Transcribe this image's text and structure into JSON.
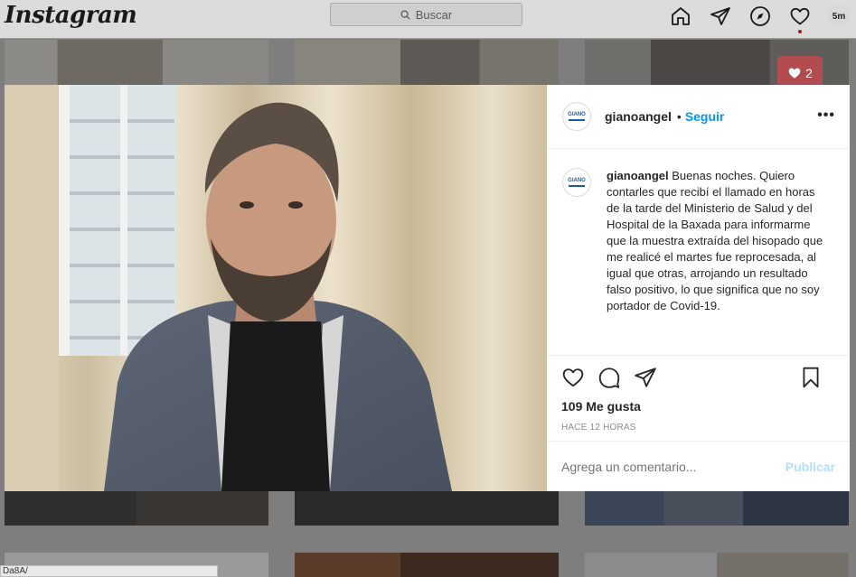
{
  "nav": {
    "logo": "Instagram",
    "search_placeholder": "Buscar",
    "avatar_initials": "5m"
  },
  "background_badge": {
    "likes": "2"
  },
  "url_hint": "Da8A/",
  "post": {
    "username": "gianoangel",
    "separator": "•",
    "follow_label": "Seguir",
    "more_label": "•••",
    "avatar_text": "GIANO",
    "caption_username": "gianoangel",
    "caption": "Buenas noches. Quiero contarles que recibí el llamado en horas de la tarde del Ministerio de Salud y del Hospital de la Baxada para informarme que la muestra extraída del hisopado que me realicé el martes fue reprocesada, al igual que otras, arrojando un resultado falso positivo, lo que significa que no soy portador de Covid-19.",
    "likes": "109 Me gusta",
    "time": "HACE 12 HORAS",
    "comment_placeholder": "Agrega un comentario...",
    "publish_label": "Publicar"
  },
  "colors": {
    "accent": "#0095f6",
    "publish_disabled": "#b2dffc",
    "notification": "#9b1a2c",
    "like_badge": "#b34c4e"
  }
}
